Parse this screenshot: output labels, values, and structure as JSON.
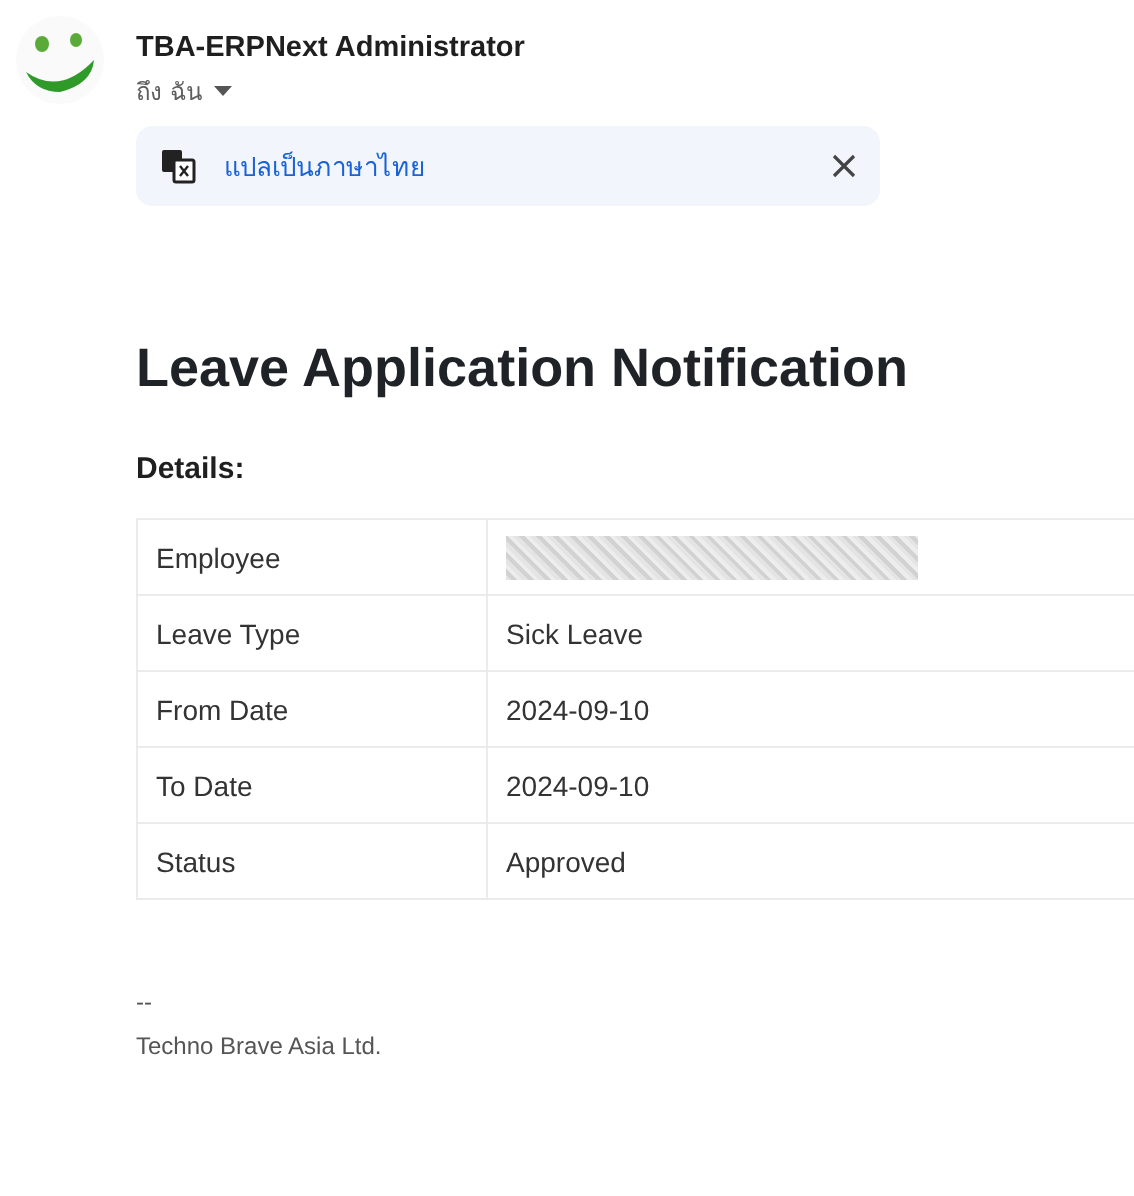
{
  "sender": {
    "name": "TBA-ERPNext Administrator",
    "recipient": "ถึง ฉัน"
  },
  "translate_bar": {
    "link": "แปลเป็นภาษาไทย"
  },
  "title": "Leave Application Notification",
  "section": "Details:",
  "rows": [
    {
      "label": "Employee",
      "redacted": true
    },
    {
      "label": "Leave Type",
      "value": "Sick Leave",
      "redacted": false
    },
    {
      "label": "From Date",
      "value": "2024-09-10",
      "redacted": false
    },
    {
      "label": "To Date",
      "value": "2024-09-10",
      "redacted": false
    },
    {
      "label": "Status",
      "value": "Approved",
      "redacted": false
    }
  ],
  "signature": {
    "separator": "--",
    "company": "Techno Brave Asia Ltd."
  }
}
